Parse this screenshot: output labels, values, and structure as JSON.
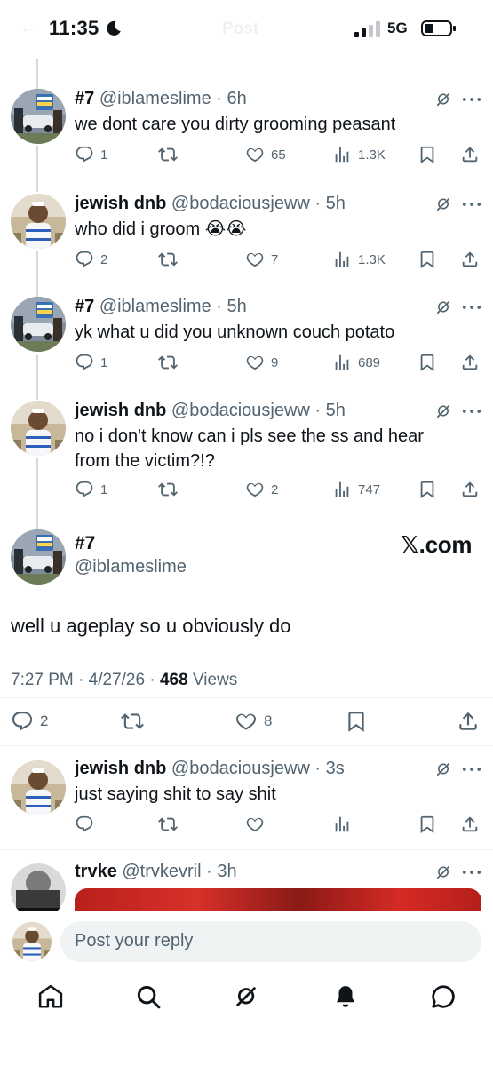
{
  "status_bar": {
    "time": "11:35",
    "network": "5G",
    "screen_title": "Post"
  },
  "tweets": [
    {
      "name": "#7",
      "handle": "@iblameslime",
      "time": "6h",
      "text": "we dont care you dirty grooming peasant",
      "replies": "1",
      "likes": "65",
      "views": "1.3K"
    },
    {
      "name": "jewish dnb",
      "handle": "@bodaciousjeww",
      "time": "5h",
      "text": "who did i groom 😭😭",
      "replies": "2",
      "likes": "7",
      "views": "1.3K"
    },
    {
      "name": "#7",
      "handle": "@iblameslime",
      "time": "5h",
      "text": "yk what u did you unknown couch potato",
      "replies": "1",
      "likes": "9",
      "views": "689"
    },
    {
      "name": "jewish dnb",
      "handle": "@bodaciousjeww",
      "time": "5h",
      "text": "no i don't know can i pls see the ss and hear from the victim?!?",
      "replies": "1",
      "likes": "2",
      "views": "747"
    }
  ],
  "main_tweet": {
    "name": "#7",
    "handle": "@iblameslime",
    "watermark": "𝕏.com",
    "text": "well u ageplay so u obviously do",
    "time": "7:27 PM",
    "date": "4/27/26",
    "views_count": "468",
    "views_label": "Views",
    "replies": "2",
    "likes": "8"
  },
  "reply_tweet": {
    "name": "jewish dnb",
    "handle": "@bodaciousjeww",
    "time": "3s",
    "text": "just saying shit to say shit"
  },
  "next_tweet": {
    "name": "trvke",
    "handle": "@trvkevril",
    "time": "3h"
  },
  "reply_bar": {
    "placeholder": "Post your reply"
  },
  "colors": {
    "text": "#0f1419",
    "secondary": "#536471",
    "divider": "#eff3f4",
    "thread_line": "#cfd9de",
    "media_red": "#d8302a"
  },
  "icons": [
    "reply-icon",
    "repost-icon",
    "like-icon",
    "views-icon",
    "bookmark-icon",
    "share-icon",
    "grok-icon",
    "more-icon",
    "home-icon",
    "search-icon",
    "bell-icon",
    "messages-icon"
  ]
}
